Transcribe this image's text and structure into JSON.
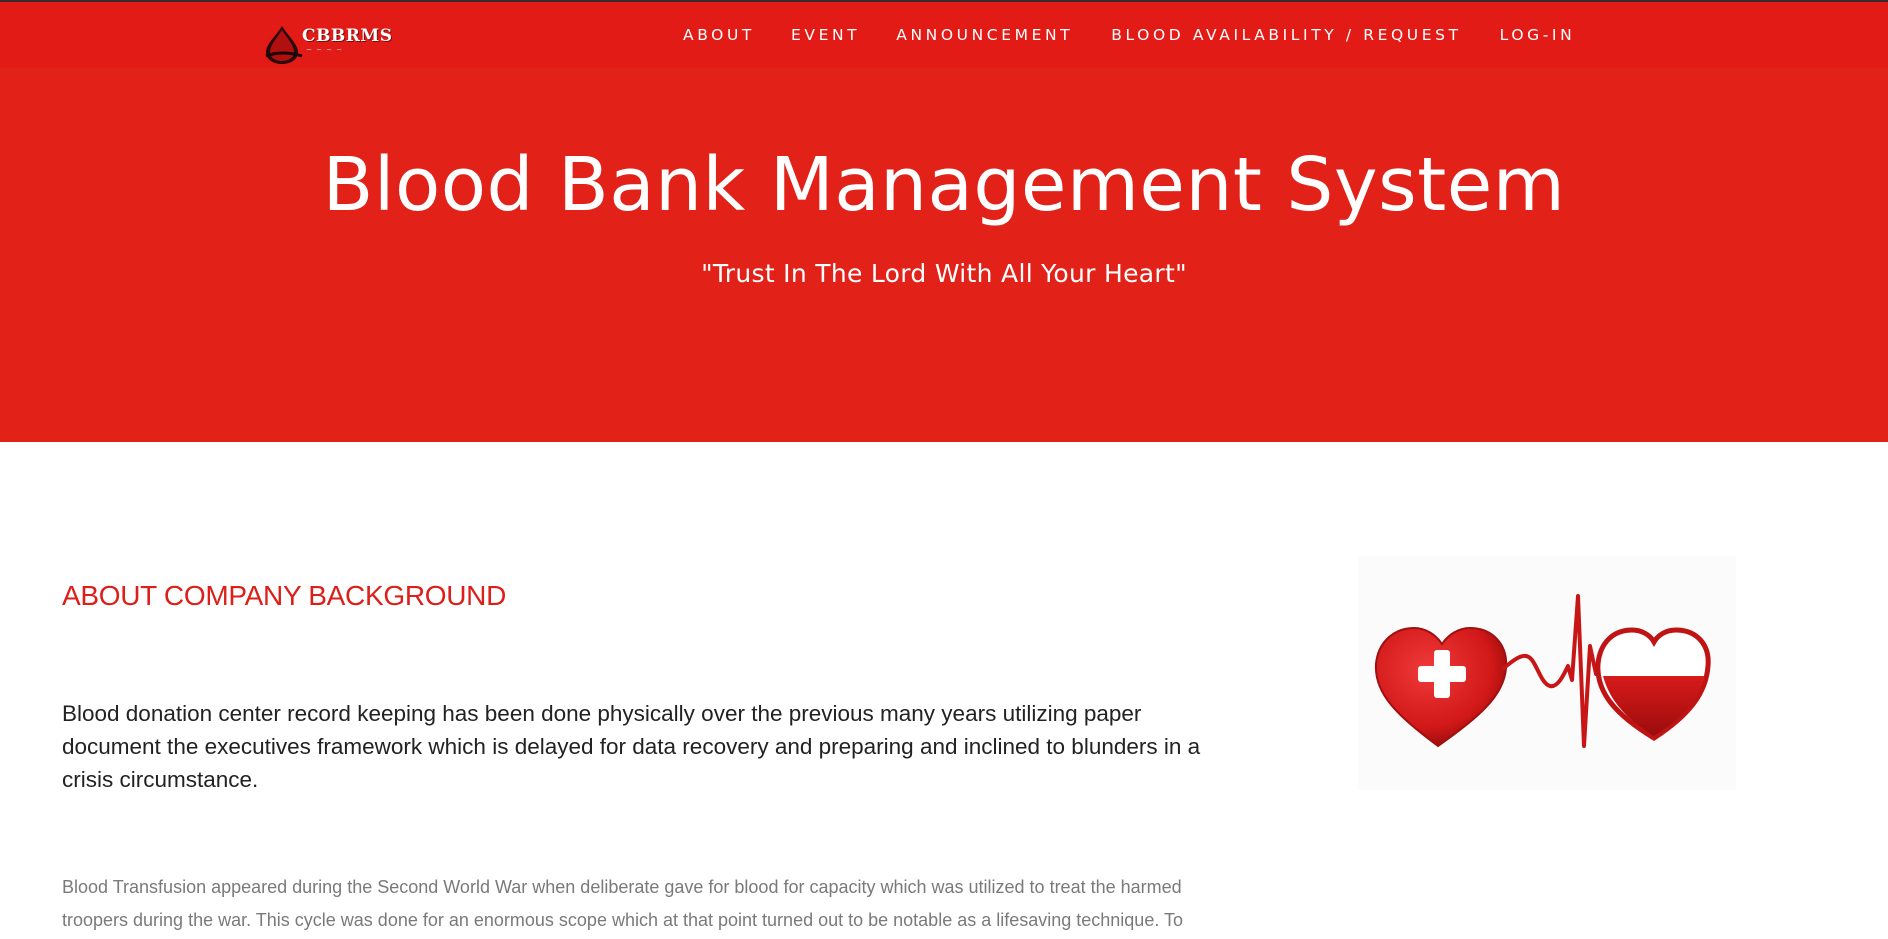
{
  "brand": {
    "logo_text": "CBBRMS",
    "logo_icon": "blood-drop-icon"
  },
  "nav": {
    "items": [
      {
        "label": "ABOUT"
      },
      {
        "label": "EVENT"
      },
      {
        "label": "ANNOUNCEMENT"
      },
      {
        "label": "BLOOD AVAILABILITY / REQUEST"
      },
      {
        "label": "LOG-IN"
      }
    ]
  },
  "hero": {
    "title": "Blood Bank Management System",
    "subtitle": "\"Trust In The Lord With All Your Heart\""
  },
  "about": {
    "heading": "ABOUT COMPANY BACKGROUND",
    "lead": "Blood donation center record keeping has been done physically over the previous many years utilizing paper document the executives framework which is delayed for data recovery and preparing and inclined to blunders in a crisis circumstance.",
    "body": "Blood Transfusion appeared during the Second World War when deliberate gave for blood for capacity which was utilized to treat the harmed troopers during the war. This cycle was done for an enormous scope which at that point turned out to be notable as a lifesaving technique. To",
    "image_icon": "hearts-heartbeat-illustration"
  },
  "colors": {
    "brand_red": "#e22119",
    "heading_red": "#dd1f1a",
    "text_dark": "#222222",
    "text_muted": "#7a7a7a"
  }
}
